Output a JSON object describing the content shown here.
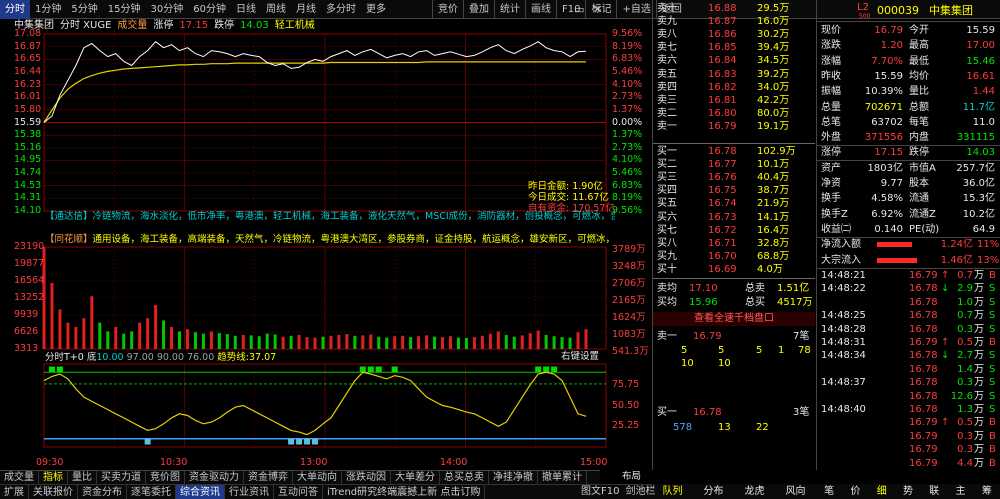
{
  "toolbar": {
    "tabs": [
      "分时",
      "1分钟",
      "5分钟",
      "15分钟",
      "30分钟",
      "60分钟",
      "日线",
      "周线",
      "月线",
      "多分时",
      "更多"
    ],
    "right": [
      "竞价",
      "叠加",
      "统计",
      "画线",
      "F10",
      "标记",
      "+自选",
      "返回"
    ]
  },
  "chart_header": {
    "name": "中集集团",
    "mode": "分时 XUGE",
    "vol_label": "成交量",
    "limit_up_label": "涨停",
    "limit_up": "17.15",
    "limit_down_label": "跌停",
    "limit_down": "14.03",
    "industry": "轻工机械"
  },
  "price_axis": {
    "left": [
      "17.08",
      "16.87",
      "16.65",
      "16.44",
      "16.23",
      "16.01",
      "15.80",
      "15.59",
      "15.38",
      "15.16",
      "14.95",
      "14.74",
      "14.53",
      "14.31",
      "14.10"
    ],
    "right": [
      "9.56%",
      "8.19%",
      "6.83%",
      "5.46%",
      "4.10%",
      "2.73%",
      "1.37%",
      "0.00%",
      "1.37%",
      "2.73%",
      "4.10%",
      "5.46%",
      "6.83%",
      "8.19%",
      "9.56%"
    ]
  },
  "amount_box": {
    "label1": "昨日金额:",
    "val1": "1.90亿",
    "label2": "今日成交:",
    "val2": "11.67亿",
    "label3": "自有资金:",
    "val3": "170.57亿"
  },
  "news1": {
    "prefix": "【通达信】",
    "text": "冷链物流，海水淡化，低市净率，粤港澳，轻工机械，海工装备，液化天然气，MSCI成份，消防器材，创投概念，可燃冰，含H"
  },
  "news2": {
    "prefix": "【同花顺】",
    "text": "通用设备，海工装备，高端装备，天然气，冷链物流，粤港澳大湾区，参股券商，证金持股，航运概念，雄安新区，可燃冰，参"
  },
  "volume_axis": {
    "left": [
      "23190",
      "19877",
      "16564",
      "13252",
      "9939",
      "6626",
      "3313"
    ],
    "right": [
      "3789万",
      "3248万",
      "2706万",
      "2165万",
      "1624万",
      "1083万",
      "541.3万"
    ]
  },
  "indicator": {
    "name": "分时T+0",
    "di_label": "底",
    "di_val": "10.00",
    "v97": "97.00",
    "v90": "90.00",
    "v76": "76.00",
    "trend_label": "趋势线:",
    "trend_val": "37.07",
    "setting": "右键设置",
    "axis": [
      "75.75",
      "50.50",
      "25.25"
    ]
  },
  "time_axis": [
    "09:30",
    "10:30",
    "13:00",
    "14:00",
    "15:00"
  ],
  "layout_label": "布局",
  "orderbook": {
    "asks": [
      {
        "label": "卖十",
        "price": "16.88",
        "vol": "29.5万"
      },
      {
        "label": "卖九",
        "price": "16.87",
        "vol": "16.0万"
      },
      {
        "label": "卖八",
        "price": "16.86",
        "vol": "30.2万"
      },
      {
        "label": "卖七",
        "price": "16.85",
        "vol": "39.4万"
      },
      {
        "label": "卖六",
        "price": "16.84",
        "vol": "34.5万"
      },
      {
        "label": "卖五",
        "price": "16.83",
        "vol": "39.2万"
      },
      {
        "label": "卖四",
        "price": "16.82",
        "vol": "34.0万"
      },
      {
        "label": "卖三",
        "price": "16.81",
        "vol": "42.2万"
      },
      {
        "label": "卖二",
        "price": "16.80",
        "vol": "80.0万"
      },
      {
        "label": "卖一",
        "price": "16.79",
        "vol": "19.1万"
      }
    ],
    "bids": [
      {
        "label": "买一",
        "price": "16.78",
        "vol": "102.9万"
      },
      {
        "label": "买二",
        "price": "16.77",
        "vol": "10.1万"
      },
      {
        "label": "买三",
        "price": "16.76",
        "vol": "40.4万"
      },
      {
        "label": "买四",
        "price": "16.75",
        "vol": "38.7万"
      },
      {
        "label": "买五",
        "price": "16.74",
        "vol": "21.9万"
      },
      {
        "label": "买六",
        "price": "16.73",
        "vol": "14.1万"
      },
      {
        "label": "买七",
        "price": "16.72",
        "vol": "16.4万"
      },
      {
        "label": "买八",
        "price": "16.71",
        "vol": "32.8万"
      },
      {
        "label": "买九",
        "price": "16.70",
        "vol": "68.8万"
      },
      {
        "label": "买十",
        "price": "16.69",
        "vol": "4.0万"
      }
    ],
    "sell_avg_label": "卖均",
    "sell_avg": "17.10",
    "sell_total_label": "总卖",
    "sell_total": "1.51亿",
    "buy_avg_label": "买均",
    "buy_avg": "15.96",
    "buy_total_label": "总买",
    "buy_total": "4517万",
    "link": "查看全速千档盘口",
    "sell1_label": "卖一",
    "sell1_price": "16.79",
    "sell1_count": "7笔",
    "sell1_queue": [
      "5",
      "5",
      "5",
      "1",
      "78",
      "10",
      "10"
    ],
    "buy1_label": "买一",
    "buy1_price": "16.78",
    "buy1_count": "3笔",
    "buy1_queue": [
      "578",
      "13",
      "22"
    ]
  },
  "quote": {
    "badge": "L2",
    "badge_sub": "500",
    "code": "000039",
    "name": "中集集团",
    "rows": [
      [
        {
          "l": "现价"
        },
        {
          "v": "16.79",
          "c": "red"
        },
        {
          "l": "今开"
        },
        {
          "v": "15.59",
          "c": "white"
        }
      ],
      [
        {
          "l": "涨跌"
        },
        {
          "v": "1.20",
          "c": "red"
        },
        {
          "l": "最高"
        },
        {
          "v": "17.00",
          "c": "red"
        }
      ],
      [
        {
          "l": "涨幅"
        },
        {
          "v": "7.70%",
          "c": "red"
        },
        {
          "l": "最低"
        },
        {
          "v": "15.46",
          "c": "green"
        }
      ],
      [
        {
          "l": "昨收"
        },
        {
          "v": "15.59",
          "c": "white"
        },
        {
          "l": "均价"
        },
        {
          "v": "16.61",
          "c": "red"
        }
      ],
      [
        {
          "l": "振幅"
        },
        {
          "v": "10.39%",
          "c": "white"
        },
        {
          "l": "量比"
        },
        {
          "v": "1.44",
          "c": "red"
        }
      ],
      [
        {
          "l": "总量"
        },
        {
          "v": "702671",
          "c": "yellow"
        },
        {
          "l": "总额"
        },
        {
          "v": "11.7亿",
          "c": "cyan"
        }
      ],
      [
        {
          "l": "总笔"
        },
        {
          "v": "63702",
          "c": "white"
        },
        {
          "l": "每笔"
        },
        {
          "v": "11.0",
          "c": "white"
        }
      ],
      [
        {
          "l": "外盘"
        },
        {
          "v": "371556",
          "c": "red"
        },
        {
          "l": "内盘"
        },
        {
          "v": "331115",
          "c": "green"
        }
      ],
      [
        {
          "l": "涨停"
        },
        {
          "v": "17.15",
          "c": "red"
        },
        {
          "l": "跌停"
        },
        {
          "v": "14.03",
          "c": "green"
        }
      ],
      [
        {
          "l": "资产"
        },
        {
          "v": "1803亿",
          "c": "white"
        },
        {
          "l": "市值A"
        },
        {
          "v": "257.7亿",
          "c": "white"
        }
      ],
      [
        {
          "l": "净资"
        },
        {
          "v": "9.77",
          "c": "white"
        },
        {
          "l": "股本"
        },
        {
          "v": "36.0亿",
          "c": "white"
        }
      ],
      [
        {
          "l": "换手"
        },
        {
          "v": "4.58%",
          "c": "white"
        },
        {
          "l": "流通"
        },
        {
          "v": "15.3亿",
          "c": "white"
        }
      ],
      [
        {
          "l": "换手Z"
        },
        {
          "v": "6.92%",
          "c": "white"
        },
        {
          "l": "流通Z"
        },
        {
          "v": "10.2亿",
          "c": "white"
        }
      ],
      [
        {
          "l": "收益㈡"
        },
        {
          "v": "0.140",
          "c": "white"
        },
        {
          "l": "PE(动)"
        },
        {
          "v": "64.9",
          "c": "white"
        }
      ]
    ],
    "flow": [
      {
        "label": "净流入额",
        "val": "1.24亿",
        "pct": "11%",
        "bar": 0.35
      },
      {
        "label": "大宗流入",
        "val": "1.46亿",
        "pct": "13%",
        "bar": 0.4
      }
    ],
    "ticks": [
      {
        "t": "14:48:21",
        "p": "16.79",
        "a": "up",
        "v": "0.7",
        "f": "万",
        "s": "B"
      },
      {
        "t": "14:48:22",
        "p": "16.78",
        "a": "dn",
        "v": "2.9",
        "f": "万",
        "s": "S"
      },
      {
        "t": "",
        "p": "16.78",
        "a": "",
        "v": "1.0",
        "f": "万",
        "s": "S"
      },
      {
        "t": "14:48:25",
        "p": "16.78",
        "a": "",
        "v": "0.7",
        "f": "万",
        "s": "S"
      },
      {
        "t": "14:48:28",
        "p": "16.78",
        "a": "",
        "v": "0.3",
        "f": "万",
        "s": "S"
      },
      {
        "t": "14:48:31",
        "p": "16.79",
        "a": "up",
        "v": "0.5",
        "f": "万",
        "s": "B"
      },
      {
        "t": "14:48:34",
        "p": "16.78",
        "a": "dn",
        "v": "2.7",
        "f": "万",
        "s": "S"
      },
      {
        "t": "",
        "p": "16.78",
        "a": "",
        "v": "1.4",
        "f": "万",
        "s": "S"
      },
      {
        "t": "14:48:37",
        "p": "16.78",
        "a": "",
        "v": "0.3",
        "f": "万",
        "s": "S"
      },
      {
        "t": "",
        "p": "16.78",
        "a": "",
        "v": "12.6",
        "f": "万",
        "s": "S"
      },
      {
        "t": "14:48:40",
        "p": "16.78",
        "a": "",
        "v": "1.3",
        "f": "万",
        "s": "S"
      },
      {
        "t": "",
        "p": "16.79",
        "a": "up",
        "v": "0.5",
        "f": "万",
        "s": "B"
      },
      {
        "t": "",
        "p": "16.79",
        "a": "",
        "v": "0.3",
        "f": "万",
        "s": "B"
      },
      {
        "t": "",
        "p": "16.79",
        "a": "",
        "v": "0.3",
        "f": "万",
        "s": "B"
      },
      {
        "t": "",
        "p": "16.79",
        "a": "",
        "v": "4.4",
        "f": "万",
        "s": "B"
      }
    ]
  },
  "bottom_tabs1": [
    "成交量",
    "指标",
    "量比",
    "买卖力道",
    "竞价图",
    "资金驱动力",
    "资金博弈",
    "大单动向",
    "涨跌动因",
    "大单差分",
    "总买总卖",
    "净挂净撤",
    "撤单累计"
  ],
  "bottom_tabs2": [
    "扩展",
    "关联报价",
    "资金分布",
    "逐笔委托",
    "综合资讯",
    "行业资讯",
    "互动问答",
    "iTrend研究终端震撼上新 点击订购"
  ],
  "bottom_tabs2_right": [
    "图文F10",
    "剑池栏"
  ],
  "side_tabs": [
    "队列",
    "分布",
    "龙虎",
    "风向"
  ],
  "side_tabs2": [
    "笔",
    "价",
    "细",
    "势",
    "联",
    "主",
    "筹"
  ],
  "chart_data": {
    "type": "line",
    "title": "",
    "x_labels": [
      "09:30",
      "10:30",
      "13:00",
      "14:00",
      "15:00"
    ],
    "prev_close": 15.59,
    "ylim": [
      14.1,
      17.08
    ],
    "price": [
      15.59,
      15.7,
      16.05,
      16.3,
      16.55,
      16.85,
      16.92,
      16.8,
      16.7,
      16.75,
      16.62,
      16.55,
      16.7,
      16.8,
      16.95,
      16.85,
      16.9,
      16.8,
      16.85,
      16.75,
      16.7,
      16.8,
      16.78,
      16.75,
      16.7,
      16.75,
      16.72,
      16.7,
      16.6,
      16.55,
      16.58,
      16.5,
      16.52,
      16.6,
      16.65,
      16.62,
      16.7,
      16.75,
      16.8,
      16.72,
      16.78,
      16.82,
      16.75,
      16.68,
      16.72,
      16.75,
      16.7,
      16.78,
      16.8,
      16.72,
      16.75,
      16.78,
      16.74,
      16.7,
      16.72,
      16.78,
      16.85,
      16.9,
      16.8,
      16.75,
      16.82,
      16.88,
      16.95,
      16.85,
      16.8,
      16.78,
      16.7,
      16.78,
      16.79
    ],
    "avg": [
      15.59,
      15.8,
      16.0,
      16.15,
      16.25,
      16.33,
      16.38,
      16.42,
      16.45,
      16.47,
      16.49,
      16.5,
      16.51,
      16.52,
      16.53,
      16.54,
      16.55,
      16.56,
      16.56,
      16.57,
      16.57,
      16.58,
      16.58,
      16.58,
      16.59,
      16.59,
      16.59,
      16.59,
      16.59,
      16.59,
      16.59,
      16.59,
      16.59,
      16.59,
      16.59,
      16.59,
      16.6,
      16.6,
      16.6,
      16.6,
      16.6,
      16.6,
      16.6,
      16.6,
      16.6,
      16.6,
      16.6,
      16.6,
      16.61,
      16.61,
      16.61,
      16.61,
      16.61,
      16.61,
      16.61,
      16.61,
      16.61,
      16.61,
      16.61,
      16.61,
      16.61,
      16.61,
      16.61,
      16.61,
      16.61,
      16.61,
      16.61,
      16.61,
      16.61
    ],
    "volume_ylim": [
      0,
      23190
    ],
    "volume": [
      23190,
      15000,
      9000,
      6000,
      5000,
      7000,
      12000,
      6000,
      4000,
      5000,
      3500,
      4000,
      6000,
      7000,
      10000,
      6500,
      5000,
      4000,
      4500,
      3800,
      3500,
      4000,
      3600,
      3400,
      3000,
      3200,
      3100,
      2900,
      3500,
      3300,
      2800,
      3000,
      3200,
      2700,
      2600,
      2800,
      3000,
      3200,
      3400,
      3000,
      3100,
      3300,
      2800,
      2600,
      2900,
      3000,
      2700,
      2900,
      3100,
      2800,
      2700,
      2900,
      2600,
      2500,
      2700,
      3000,
      3500,
      4000,
      3200,
      2800,
      3100,
      3600,
      4200,
      3200,
      2900,
      2700,
      2600,
      3800,
      4500
    ],
    "indicator_ylim": [
      0,
      100
    ],
    "trend": [
      80,
      85,
      88,
      82,
      70,
      60,
      55,
      50,
      45,
      40,
      35,
      30,
      25,
      20,
      22,
      28,
      35,
      40,
      38,
      32,
      28,
      30,
      35,
      42,
      48,
      50,
      45,
      40,
      35,
      30,
      25,
      20,
      18,
      15,
      20,
      28,
      35,
      50,
      65,
      80,
      90,
      88,
      85,
      82,
      86,
      84,
      80,
      70,
      60,
      55,
      50,
      48,
      45,
      42,
      40,
      35,
      30,
      25,
      30,
      45,
      60,
      75,
      88,
      90,
      88,
      80,
      60,
      40,
      37
    ]
  }
}
